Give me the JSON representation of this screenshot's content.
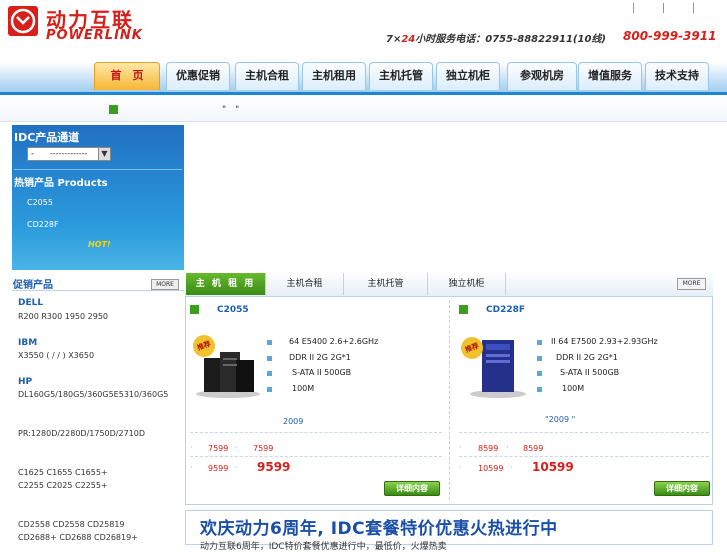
{
  "header": {
    "brand_cn": "动力互联",
    "brand_en": "POWERLINK",
    "hotline_prefix": "7×",
    "hotline_hours": "24",
    "hotline_text": "小时服务电话：0755-88822911(10线)",
    "toll_free": "800-999-3911"
  },
  "nav": {
    "tabs": [
      "首　页",
      "优惠促销",
      "主机合租",
      "主机租用",
      "主机托管",
      "独立机柜",
      "参观机房",
      "增值服务",
      "技术支持"
    ]
  },
  "subbar": {
    "text": "\"　\""
  },
  "sidebar": {
    "idc_title": "IDC产品通道",
    "select_value": "-　　-------------",
    "select_arrow": "▼",
    "hot_title": "热销产品  Products",
    "hot_items": [
      "C2055",
      "CD228F"
    ],
    "hot_badge": "HOT!",
    "promo_title": "促销产品",
    "promo_more": "MORE",
    "groups": [
      {
        "brand": "DELL",
        "models": [
          "R200 R300 1950 2950"
        ]
      },
      {
        "brand": "IBM",
        "models": [
          "X3550 (  /  /  ) X3650"
        ]
      },
      {
        "brand": "HP",
        "models": [
          "DL160G5/180G5/360G5E5310/360G5",
          "",
          "PR:1280D/2280D/1750D/2710D",
          "",
          "",
          "C1625 C1655 C1655+",
          "C2255 C2025 C2255+",
          "",
          "",
          "CD2558 CD2558 CD25819",
          "CD2688+ CD2688 CD26819+"
        ]
      }
    ]
  },
  "panel": {
    "tabs": [
      "主 机 租 用",
      "主机合租",
      "主机托管",
      "独立机柜"
    ],
    "more": "MORE",
    "products": [
      {
        "name": "C2055",
        "badge": "推荐",
        "specs": [
          "64  E5400 2.6+2.6GHz",
          "DDR II 2G 2G*1",
          "S-ATA II 500GB",
          "100M"
        ],
        "date": "2009",
        "price_rows": [
          {
            "label": "·",
            "old": "7599",
            "sep": "·",
            "new": "7599"
          },
          {
            "label": "·",
            "old": "9599",
            "sep": "·",
            "new": "9599"
          }
        ],
        "detail": "详细内容"
      },
      {
        "name": "CD228F",
        "badge": "推荐",
        "specs": [
          "II  64  E7500 2.93+2.93GHz",
          "DDR II 2G 2G*1",
          "S-ATA II 500GB",
          "100M"
        ],
        "date": "\"2009    \"",
        "price_rows": [
          {
            "label": "·",
            "old": "8599",
            "sep": "·",
            "new": "8599"
          },
          {
            "label": "·",
            "old": "10599",
            "sep": "·",
            "new": "10599"
          }
        ],
        "detail": "详细内容"
      }
    ]
  },
  "banner": {
    "headline": "欢庆动力6周年, IDC套餐特价优惠火热进行中",
    "sub": "动力互联6周年，IDC特价套餐优惠进行中，最低价，火爆热卖"
  }
}
